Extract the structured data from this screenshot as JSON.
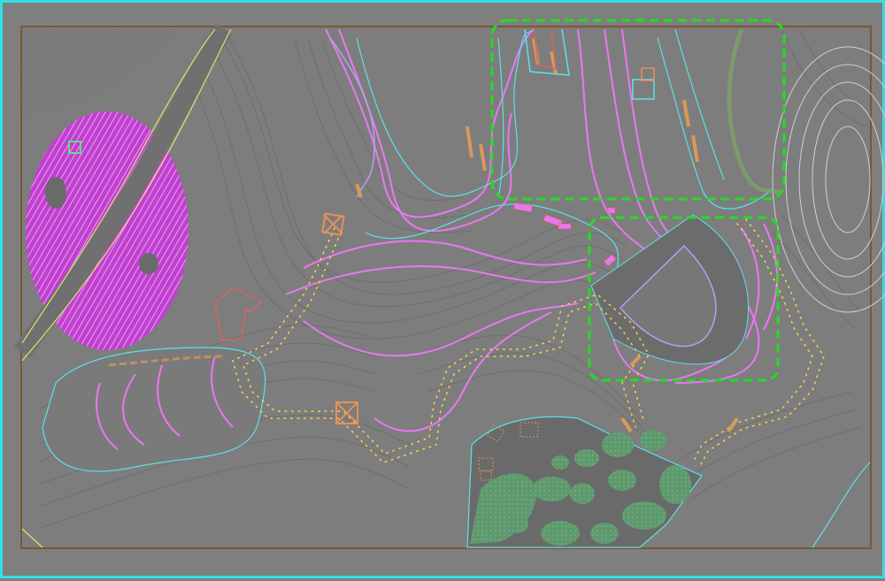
{
  "view": {
    "title": "",
    "background_color": "#808080",
    "viewport_border_color": "#2fe0e6",
    "sheet_border_color": "#7a4a1e"
  },
  "layers": {
    "contour_minor_color": "#6e6e6e",
    "contour_major_color": "#6a6a6a",
    "road_edge_color": "#e2e26a",
    "path_outline_color": "#5ee0e8",
    "trail_color": "#ffd54a",
    "trail_edge_color": "#e0a040",
    "wetland_magenta": "#d24ad8",
    "stream_line_color": "#e878f0",
    "vegetation_green": "#5f9a6e",
    "highlight_box_color": "#22dd22",
    "structure_orange": "#e8905a",
    "structure_red": "#e06060",
    "lavender_line": "#b4a0f0"
  },
  "highlight_regions": [
    {
      "id": "region-north"
    },
    {
      "id": "region-east"
    }
  ]
}
